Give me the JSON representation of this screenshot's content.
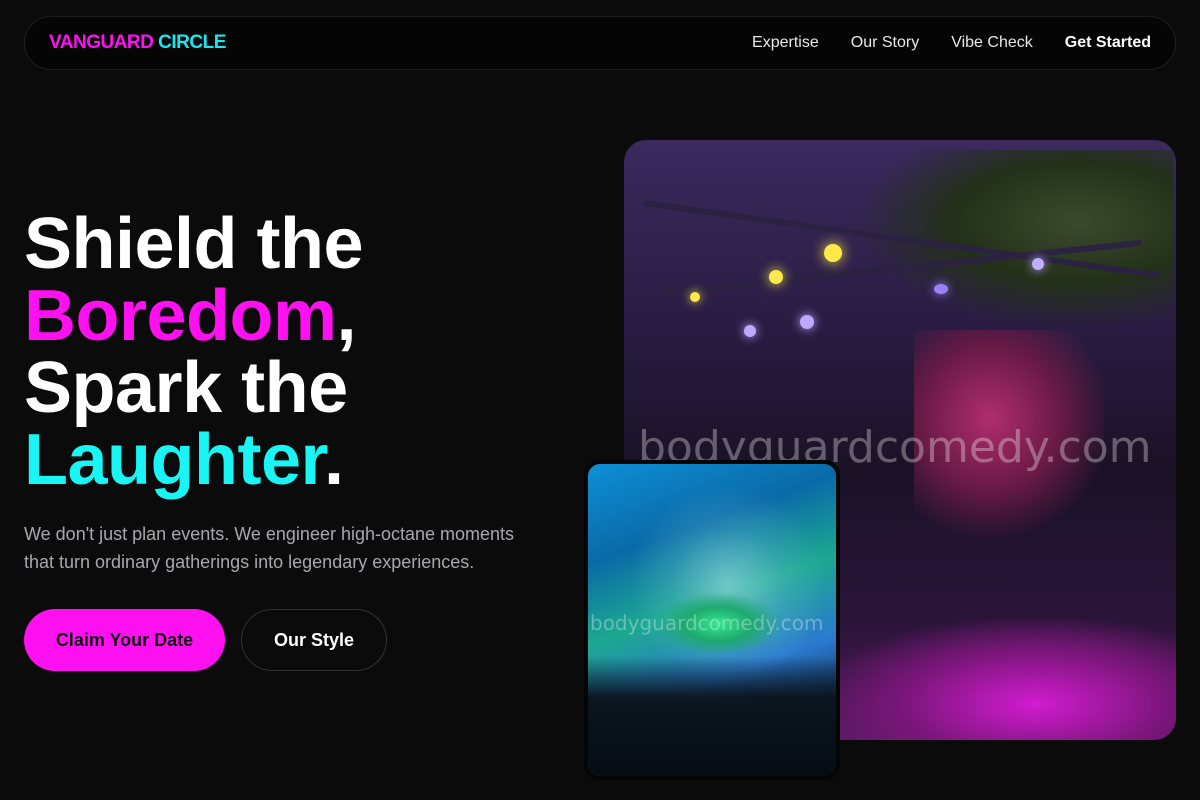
{
  "nav": {
    "logo_part1": "VANGUARD",
    "logo_part2": "CIRCLE",
    "links": [
      "Expertise",
      "Our Story",
      "Vibe Check"
    ],
    "cta": "Get Started"
  },
  "hero": {
    "line1": "Shield the",
    "line2_highlight": "Boredom",
    "line2_suffix": ",",
    "line3": "Spark the",
    "line4_highlight": "Laughter",
    "line4_suffix": ".",
    "subtitle": "We don't just plan events. We engineer high-octane moments that turn ordinary gatherings into legendary experiences.",
    "primary_button": "Claim Your Date",
    "secondary_button": "Our Style"
  },
  "images": {
    "main_watermark": "bodyguardcomedy.com",
    "small_watermark": "bodyguardcomedy.com"
  },
  "colors": {
    "accent_pink": "#ff10f0",
    "accent_cyan": "#19f4f4",
    "background": "#0b0b0b"
  }
}
